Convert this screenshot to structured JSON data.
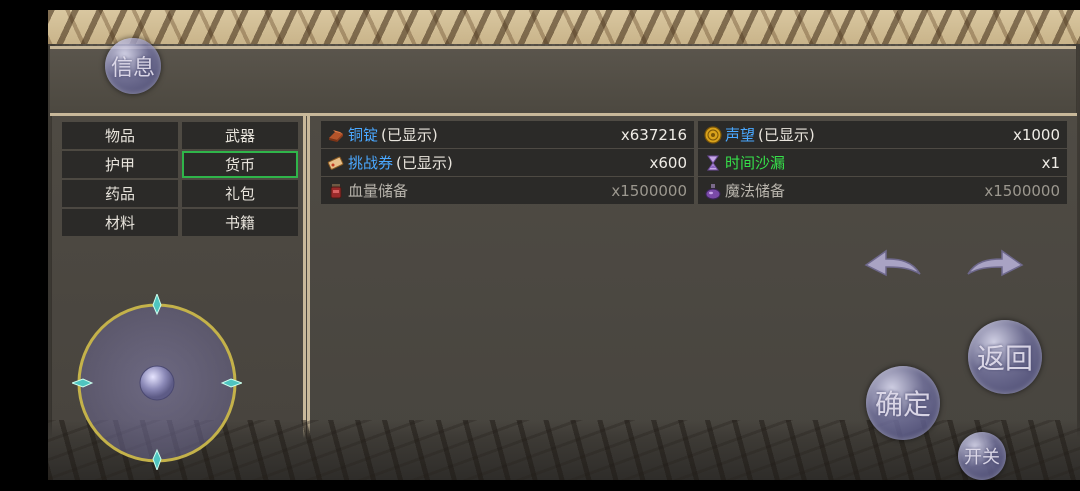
{
  "buttons": {
    "info": "信息",
    "return": "返回",
    "confirm": "确定",
    "toggle": "开关"
  },
  "categories": [
    {
      "label": "物品",
      "active": false
    },
    {
      "label": "武器",
      "active": false
    },
    {
      "label": "护甲",
      "active": false
    },
    {
      "label": "货币",
      "active": true
    },
    {
      "label": "药品",
      "active": false
    },
    {
      "label": "礼包",
      "active": false
    },
    {
      "label": "材料",
      "active": false
    },
    {
      "label": "书籍",
      "active": false
    }
  ],
  "items": [
    {
      "name": "铜锭",
      "suffix": "(已显示)",
      "qty": "x637216",
      "icon": "copper-ingot-icon"
    },
    {
      "name": "声望",
      "suffix": "(已显示)",
      "qty": "x1000",
      "icon": "reputation-coin-icon"
    },
    {
      "name": "挑战券",
      "suffix": "(已显示)",
      "qty": "x600",
      "icon": "challenge-ticket-icon"
    },
    {
      "name": "时间沙漏",
      "suffix": "",
      "qty": "x1",
      "icon": "hourglass-icon"
    },
    {
      "name": "血量储备",
      "suffix": "",
      "qty": "x1500000",
      "icon": "health-jar-icon"
    },
    {
      "name": "魔法储备",
      "suffix": "",
      "qty": "x1500000",
      "icon": "mana-flask-icon"
    }
  ],
  "colors": {
    "active_border": "#2fb54a",
    "name_blue": "#4aa8ff",
    "name_green": "#36e04a",
    "frame": "#c8b89a"
  }
}
